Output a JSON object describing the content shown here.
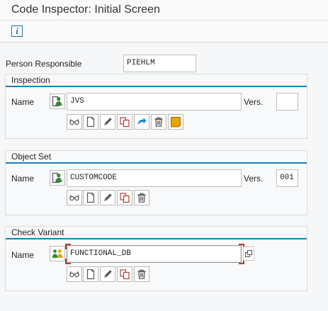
{
  "window": {
    "title": "Code Inspector: Initial Screen"
  },
  "toolbar": {
    "info_icon": "info-icon"
  },
  "person_responsible": {
    "label": "Person Responsible",
    "value": "PIEHLM"
  },
  "inspection": {
    "group_label": "Inspection",
    "name_label": "Name",
    "name_value": "JVS",
    "vers_label": "Vers.",
    "vers_value": "",
    "icons": [
      "display-icon",
      "create-icon",
      "edit-icon",
      "copy-icon",
      "execute-icon",
      "delete-icon",
      "results-icon"
    ]
  },
  "object_set": {
    "group_label": "Object Set",
    "name_label": "Name",
    "name_value": "CUSTOMCODE",
    "vers_label": "Vers.",
    "vers_value": "001",
    "icons": [
      "display-icon",
      "create-icon",
      "edit-icon",
      "copy-icon",
      "delete-icon"
    ]
  },
  "check_variant": {
    "group_label": "Check Variant",
    "name_label": "Name",
    "name_value": "FUNCTIONAL_DB",
    "icons": [
      "display-icon",
      "create-icon",
      "edit-icon",
      "copy-icon",
      "delete-icon"
    ]
  },
  "colors": {
    "accent": "#1b7fb8",
    "focus": "#c0392b",
    "person": "#2e8b3a"
  }
}
